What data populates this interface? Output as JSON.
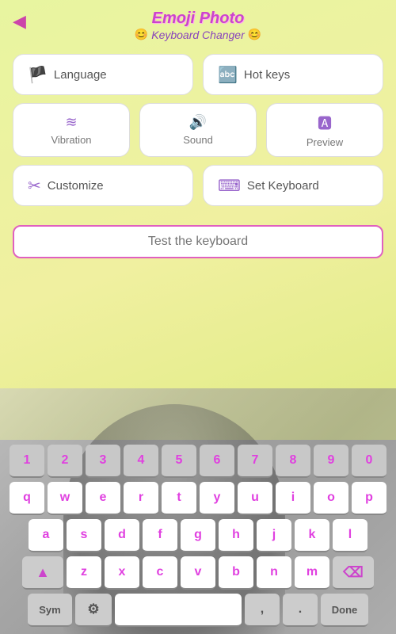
{
  "header": {
    "back_label": "◀",
    "title_line1": "Emoji Photo",
    "title_line2": "Keyboard Changer",
    "emoji_left": "😊",
    "emoji_right": "😊"
  },
  "settings": {
    "language_label": "Language",
    "language_icon": "🏴",
    "hotkeys_label": "Hot keys",
    "hotkeys_icon": "🔤",
    "vibration_label": "Vibration",
    "vibration_icon": "≋",
    "sound_label": "Sound",
    "sound_icon": "🔊",
    "preview_label": "Preview",
    "preview_icon": "🅰",
    "customize_label": "Customize",
    "customize_icon": "✂",
    "setkeyboard_label": "Set Keyboard",
    "setkeyboard_icon": "⌨"
  },
  "test_input": {
    "placeholder": "Test the keyboard",
    "value": ""
  },
  "keyboard": {
    "row0": [
      "1",
      "2",
      "3",
      "4",
      "5",
      "6",
      "7",
      "8",
      "9",
      "0"
    ],
    "row1": [
      "q",
      "w",
      "e",
      "r",
      "t",
      "y",
      "u",
      "i",
      "o",
      "p"
    ],
    "row2": [
      "a",
      "s",
      "d",
      "f",
      "g",
      "h",
      "j",
      "k",
      "l"
    ],
    "row3": [
      "z",
      "x",
      "c",
      "v",
      "b",
      "n",
      "m"
    ],
    "sym_label": "Sym",
    "gear_icon": "⚙",
    "space_label": "",
    "comma_label": ",",
    "period_label": ".",
    "done_label": "Done",
    "shift_icon": "▲",
    "backspace_icon": "⌫"
  },
  "colors": {
    "accent": "#cc44cc",
    "pink": "#e040e0",
    "bg_gradient_start": "#e8f5a0",
    "bg_gradient_end": "#d4e870"
  }
}
